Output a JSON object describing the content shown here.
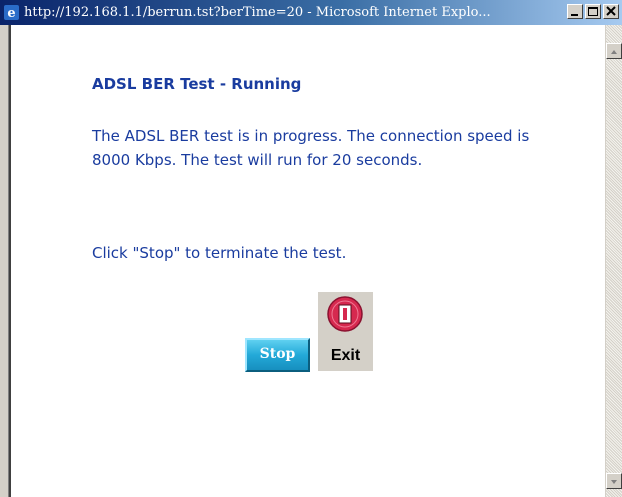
{
  "window": {
    "title": "http://192.168.1.1/berrun.tst?berTime=20 - Microsoft Internet Explo...",
    "icon": "ie-icon",
    "controls": [
      "minimize-icon",
      "maximize-icon",
      "close-icon"
    ]
  },
  "page": {
    "heading": "ADSL BER Test - Running",
    "progress_text": "The ADSL BER test is in progress. The connection speed is 8000 Kbps. The test will run for 20 seconds.",
    "instruction_text": "Click \"Stop\" to terminate the test.",
    "text_color": "#1a3c9f"
  },
  "buttons": {
    "stop_label": "Stop",
    "exit_label": "Exit",
    "exit_icon": "exit-power-icon",
    "stop_color": "#23a9d8",
    "exit_icon_color": "#d6294f"
  }
}
